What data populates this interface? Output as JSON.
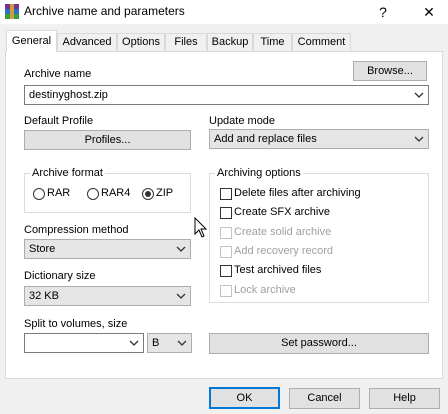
{
  "window": {
    "title": "Archive name and parameters",
    "help_glyph": "?",
    "close_glyph": "✕",
    "icon": "winrar-books-icon"
  },
  "tabs": [
    {
      "label": "General",
      "active": true
    },
    {
      "label": "Advanced",
      "active": false
    },
    {
      "label": "Options",
      "active": false
    },
    {
      "label": "Files",
      "active": false
    },
    {
      "label": "Backup",
      "active": false
    },
    {
      "label": "Time",
      "active": false
    },
    {
      "label": "Comment",
      "active": false
    }
  ],
  "general": {
    "archive_name_label": "Archive name",
    "browse_label": "Browse...",
    "archive_name_value": "destinyghost.zip",
    "default_profile_label": "Default Profile",
    "profiles_label": "Profiles...",
    "update_mode_label": "Update mode",
    "update_mode_value": "Add and replace files",
    "archive_format_label": "Archive format",
    "formats": [
      {
        "label": "RAR",
        "selected": false
      },
      {
        "label": "RAR4",
        "selected": false
      },
      {
        "label": "ZIP",
        "selected": true
      }
    ],
    "archiving_options_label": "Archiving options",
    "options": [
      {
        "label": "Delete files after archiving",
        "checked": false,
        "enabled": true
      },
      {
        "label": "Create SFX archive",
        "checked": false,
        "enabled": true
      },
      {
        "label": "Create solid archive",
        "checked": false,
        "enabled": false
      },
      {
        "label": "Add recovery record",
        "checked": false,
        "enabled": false
      },
      {
        "label": "Test archived files",
        "checked": false,
        "enabled": true
      },
      {
        "label": "Lock archive",
        "checked": false,
        "enabled": false
      }
    ],
    "compression_method_label": "Compression method",
    "compression_method_value": "Store",
    "dictionary_size_label": "Dictionary size",
    "dictionary_size_value": "32 KB",
    "split_label": "Split to volumes, size",
    "split_value": "",
    "split_unit": "B",
    "set_password_label": "Set password..."
  },
  "footer": {
    "ok": "OK",
    "cancel": "Cancel",
    "help": "Help"
  }
}
